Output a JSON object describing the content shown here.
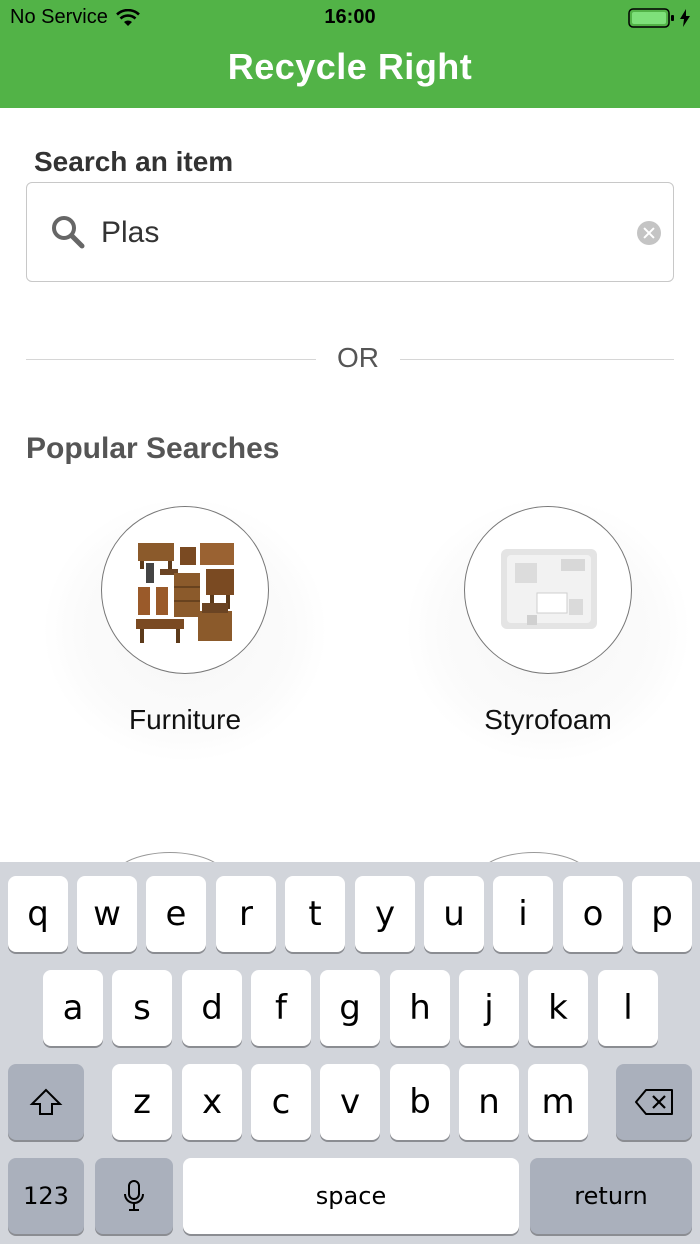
{
  "status_bar": {
    "carrier": "No Service",
    "time": "16:00"
  },
  "nav": {
    "title": "Recycle Right"
  },
  "search": {
    "label": "Search an item",
    "value": "Plas"
  },
  "divider": {
    "text": "OR"
  },
  "popular": {
    "title": "Popular Searches",
    "items": [
      {
        "label": "Furniture",
        "icon": "furniture-icon"
      },
      {
        "label": "Styrofoam",
        "icon": "styrofoam-icon"
      }
    ]
  },
  "keyboard": {
    "row1": [
      "q",
      "w",
      "e",
      "r",
      "t",
      "y",
      "u",
      "i",
      "o",
      "p"
    ],
    "row2": [
      "a",
      "s",
      "d",
      "f",
      "g",
      "h",
      "j",
      "k",
      "l"
    ],
    "row3": [
      "z",
      "x",
      "c",
      "v",
      "b",
      "n",
      "m"
    ],
    "numbers_label": "123",
    "space_label": "space",
    "return_label": "return"
  },
  "colors": {
    "brand_green": "#52b347",
    "keyboard_bg": "#d2d5db"
  }
}
